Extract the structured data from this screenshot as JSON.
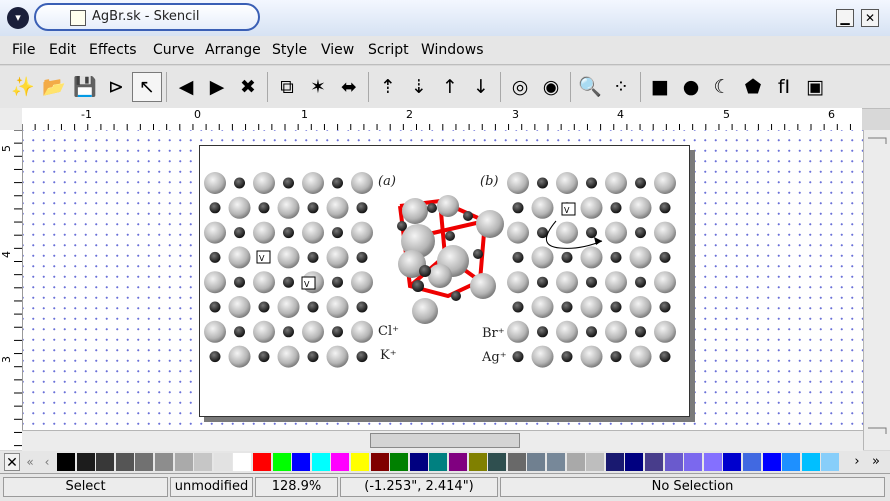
{
  "window": {
    "title": "AgBr.sk - Skencil",
    "menu_glyph": "▾",
    "minimize_glyph": "▁",
    "close_glyph": "✕"
  },
  "menu": [
    "File",
    "Edit",
    "Effects",
    "Curve",
    "Arrange",
    "Style",
    "View",
    "Script",
    "Windows"
  ],
  "toolbar": {
    "tools": [
      {
        "name": "new-document-icon",
        "glyph": "✨"
      },
      {
        "name": "open-document-icon",
        "glyph": "📂"
      },
      {
        "name": "save-document-icon",
        "glyph": "💾"
      },
      {
        "name": "edit-node-tool-icon",
        "glyph": "⊳"
      },
      {
        "name": "select-pointer-icon",
        "glyph": "↖",
        "active": true
      },
      {
        "name": "undo-icon",
        "glyph": "◀"
      },
      {
        "name": "redo-icon",
        "glyph": "▶"
      },
      {
        "name": "delete-icon",
        "glyph": "✖"
      },
      {
        "name": "group-icon",
        "glyph": "⧉"
      },
      {
        "name": "ungroup-icon",
        "glyph": "✶"
      },
      {
        "name": "blend-icon",
        "glyph": "⬌"
      },
      {
        "name": "move-to-top-icon",
        "glyph": "⇡"
      },
      {
        "name": "move-to-bottom-icon",
        "glyph": "⇣"
      },
      {
        "name": "move-one-up-icon",
        "glyph": "↑"
      },
      {
        "name": "move-one-down-icon",
        "glyph": "↓"
      },
      {
        "name": "guide-snap-icon",
        "glyph": "◎"
      },
      {
        "name": "object-snap-icon",
        "glyph": "◉"
      },
      {
        "name": "zoom-icon",
        "glyph": "🔍"
      },
      {
        "name": "grid-snap-icon",
        "glyph": "⁘"
      },
      {
        "name": "rectangle-tool-icon",
        "glyph": "■"
      },
      {
        "name": "ellipse-tool-icon",
        "glyph": "●"
      },
      {
        "name": "bezier-tool-icon",
        "glyph": "☾"
      },
      {
        "name": "polygon-tool-icon",
        "glyph": "⬟"
      },
      {
        "name": "text-tool-icon",
        "glyph": "fI"
      },
      {
        "name": "image-tool-icon",
        "glyph": "▣"
      }
    ]
  },
  "ruler": {
    "h_labels": [
      "-1",
      "0",
      "1",
      "2",
      "3",
      "4",
      "5",
      "6"
    ],
    "v_labels": [
      "5",
      "4",
      "3"
    ]
  },
  "figure": {
    "label_a": "(a)",
    "label_b": "(b)",
    "cl": "Cl⁺",
    "k": "K⁺",
    "br": "Br⁺",
    "ag": "Ag⁺"
  },
  "palette": {
    "left_controls": [
      "✕",
      "«",
      "‹"
    ],
    "right_controls": [
      "›",
      "»"
    ],
    "colors": [
      "#000000",
      "#1c1c1c",
      "#383838",
      "#555555",
      "#717171",
      "#8d8d8d",
      "#aaaaaa",
      "#c6c6c6",
      "#e2e2e2",
      "#ffffff",
      "#ff0000",
      "#00ff00",
      "#0000ff",
      "#00ffff",
      "#ff00ff",
      "#ffff00",
      "#800000",
      "#008000",
      "#000080",
      "#008080",
      "#800080",
      "#808000",
      "#2f4f4f",
      "#696969",
      "#708090",
      "#778899",
      "#a9a9a9",
      "#bebebe",
      "#191970",
      "#000080",
      "#483d8b",
      "#6a5acd",
      "#7b68ee",
      "#8470ff",
      "#0000cd",
      "#4169e1",
      "#0000ff",
      "#1e90ff",
      "#00bfff",
      "#87cefa"
    ]
  },
  "status": {
    "mode": "Select",
    "doc_state": "unmodified",
    "zoom": "128.9%",
    "coords": "(-1.253\", 2.414\")",
    "selection": "No Selection"
  }
}
